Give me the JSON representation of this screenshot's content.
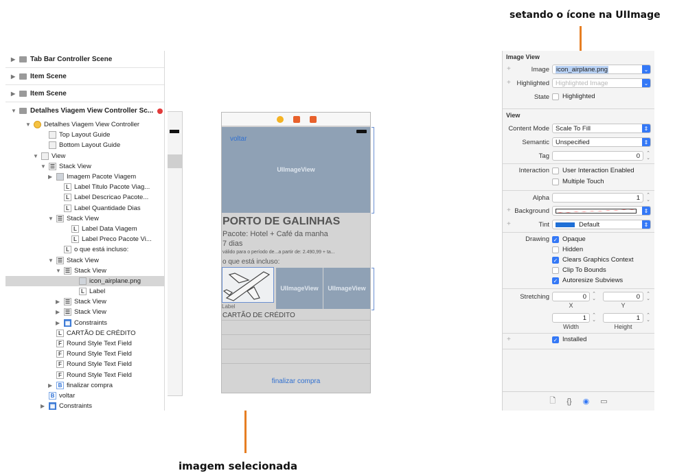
{
  "annotations": {
    "top": "setando o ícone na UIImage",
    "bottom": "imagem selecionada"
  },
  "navigator": {
    "scenes": [
      {
        "label": "Tab Bar Controller Scene"
      },
      {
        "label": "Item Scene"
      },
      {
        "label": "Item Scene"
      },
      {
        "label": "Detalhes Viagem View Controller Sc..."
      }
    ],
    "tree": [
      {
        "label": "Detalhes Viagem View Controller",
        "indent": 1,
        "disc": "▼",
        "icon": "vc"
      },
      {
        "label": "Top Layout Guide",
        "indent": 3,
        "disc": "",
        "icon": "box"
      },
      {
        "label": "Bottom Layout Guide",
        "indent": 3,
        "disc": "",
        "icon": "box"
      },
      {
        "label": "View",
        "indent": 2,
        "disc": "▼",
        "icon": "box"
      },
      {
        "label": "Stack View",
        "indent": 3,
        "disc": "▼",
        "icon": "stack"
      },
      {
        "label": "Imagem Pacote Viagem",
        "indent": 4,
        "disc": "▶",
        "icon": "img"
      },
      {
        "label": "Label Titulo Pacote Viag...",
        "indent": 5,
        "disc": "",
        "icon": "L"
      },
      {
        "label": "Label Descricao Pacote...",
        "indent": 5,
        "disc": "",
        "icon": "L"
      },
      {
        "label": "Label Quantidade Dias",
        "indent": 5,
        "disc": "",
        "icon": "L"
      },
      {
        "label": "Stack View",
        "indent": 4,
        "disc": "▼",
        "icon": "stack"
      },
      {
        "label": "Label Data Viagem",
        "indent": 6,
        "disc": "",
        "icon": "L"
      },
      {
        "label": "Label Preco Pacote Vi...",
        "indent": 6,
        "disc": "",
        "icon": "L"
      },
      {
        "label": "o que está incluso:",
        "indent": 5,
        "disc": "",
        "icon": "L"
      },
      {
        "label": "Stack View",
        "indent": 4,
        "disc": "▼",
        "icon": "stack"
      },
      {
        "label": "Stack View",
        "indent": 5,
        "disc": "▼",
        "icon": "stack"
      },
      {
        "label": "icon_airplane.png",
        "indent": 7,
        "disc": "",
        "icon": "img",
        "selected": true
      },
      {
        "label": "Label",
        "indent": 7,
        "disc": "",
        "icon": "L"
      },
      {
        "label": "Stack View",
        "indent": 5,
        "disc": "▶",
        "icon": "stack"
      },
      {
        "label": "Stack View",
        "indent": 5,
        "disc": "▶",
        "icon": "stack"
      },
      {
        "label": "Constraints",
        "indent": 5,
        "disc": "▶",
        "icon": "cons"
      },
      {
        "label": "CARTÃO DE CRÉDITO",
        "indent": 4,
        "disc": "",
        "icon": "L"
      },
      {
        "label": "Round Style Text Field",
        "indent": 4,
        "disc": "",
        "icon": "F"
      },
      {
        "label": "Round Style Text Field",
        "indent": 4,
        "disc": "",
        "icon": "F"
      },
      {
        "label": "Round Style Text Field",
        "indent": 4,
        "disc": "",
        "icon": "F"
      },
      {
        "label": "Round Style Text Field",
        "indent": 4,
        "disc": "",
        "icon": "F"
      },
      {
        "label": "finalizar compra",
        "indent": 4,
        "disc": "▶",
        "icon": "B"
      },
      {
        "label": "voltar",
        "indent": 3,
        "disc": "",
        "icon": "B"
      },
      {
        "label": "Constraints",
        "indent": 3,
        "disc": "▶",
        "icon": "cons"
      }
    ]
  },
  "canvas": {
    "voltar": "voltar",
    "hero_label": "UIImageView",
    "title": "PORTO DE GALINHAS",
    "pacote": "Pacote: Hotel + Café da manha",
    "dias": "7 dias",
    "valido": "válido para o período de...a partir de: 2.490,99 + ta...",
    "incluso": "o que está incluso:",
    "thumb_label": "UIImageView",
    "label_small": "Label",
    "cartao": "CARTÃO DE CRÉDITO",
    "finalizar": "finalizar compra"
  },
  "inspector": {
    "image_view": {
      "section": "Image View",
      "image_label": "Image",
      "image_value": "icon_airplane.png",
      "highlighted_label": "Highlighted",
      "highlighted_placeholder": "Highlighted Image",
      "state_label": "State",
      "state_option": "Highlighted"
    },
    "view": {
      "section": "View",
      "content_mode_label": "Content Mode",
      "content_mode_value": "Scale To Fill",
      "semantic_label": "Semantic",
      "semantic_value": "Unspecified",
      "tag_label": "Tag",
      "tag_value": "0",
      "interaction_label": "Interaction",
      "user_interaction": "User Interaction Enabled",
      "multiple_touch": "Multiple Touch",
      "alpha_label": "Alpha",
      "alpha_value": "1",
      "background_label": "Background",
      "tint_label": "Tint",
      "tint_value": "Default",
      "drawing_label": "Drawing",
      "opaque": "Opaque",
      "hidden": "Hidden",
      "clears": "Clears Graphics Context",
      "clip": "Clip To Bounds",
      "autoresize": "Autoresize Subviews",
      "stretching_label": "Stretching",
      "stretch_x_value": "0",
      "stretch_y_value": "0",
      "x_label": "X",
      "y_label": "Y",
      "width_value": "1",
      "height_value": "1",
      "width_label": "Width",
      "height_label": "Height",
      "installed": "Installed"
    },
    "colors": {
      "accent": "#3478f6",
      "tint_swatch": "#1f6fd6"
    }
  }
}
